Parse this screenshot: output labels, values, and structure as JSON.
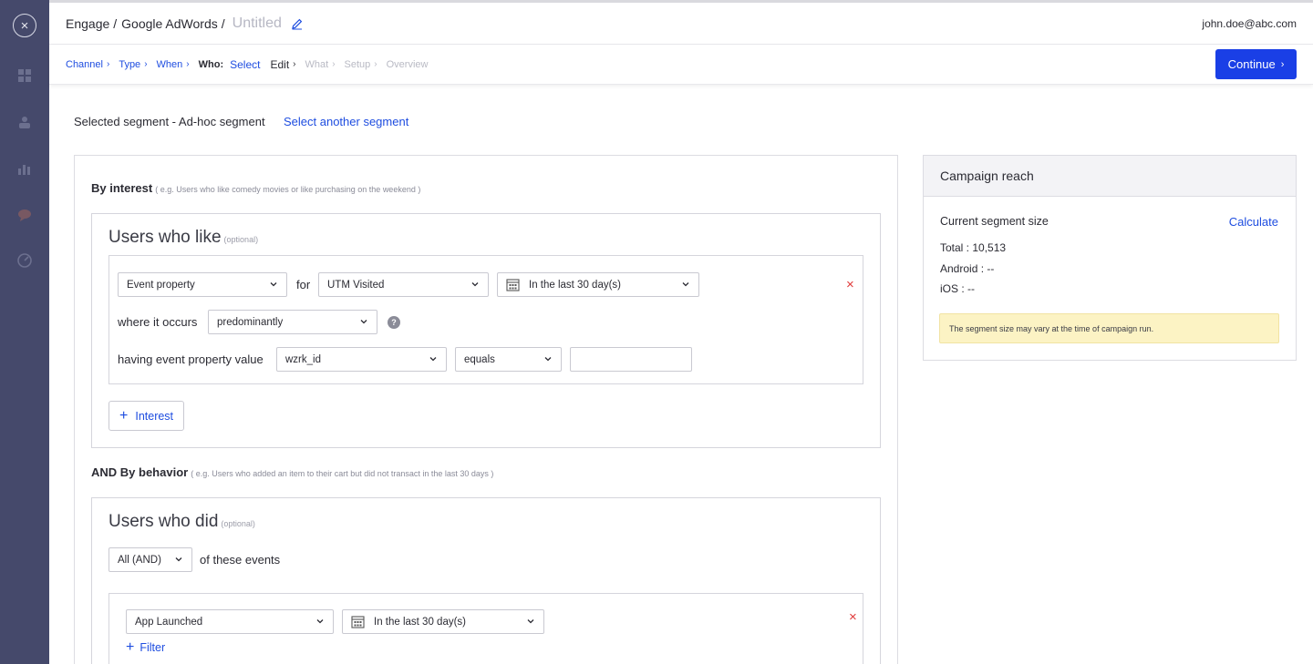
{
  "sidebar": {
    "close_symbol": "×",
    "items": [
      {
        "icon": "dashboard-icon"
      },
      {
        "icon": "segments-icon"
      },
      {
        "icon": "analytics-icon"
      },
      {
        "icon": "engage-icon"
      },
      {
        "icon": "gauge-icon"
      }
    ]
  },
  "header": {
    "crumb_1": "Engage",
    "crumb_2": "Google AdWords",
    "separator": "/",
    "title": "Untitled",
    "user_email": "john.doe@abc.com"
  },
  "steps": {
    "channel": "Channel",
    "type": "Type",
    "when": "When",
    "who": "Who:",
    "select": "Select",
    "edit": "Edit",
    "what": "What",
    "setup": "Setup",
    "overview": "Overview",
    "continue_label": "Continue"
  },
  "segment": {
    "selected_text": "Selected segment - Ad-hoc segment",
    "select_another": "Select another segment"
  },
  "interest": {
    "title": "By interest",
    "hint": "( e.g. Users who like comedy movies or like purchasing on the weekend )",
    "box_title": "Users who like",
    "optional": "(optional)",
    "property_select": "Event property",
    "for_label": "for",
    "event_select": "UTM Visited",
    "time_select": "In the last 30 day(s)",
    "where_label": "where it occurs",
    "occurs_select": "predominantly",
    "help": "?",
    "having_label": "having event property value",
    "value_select": "wzrk_id",
    "operator_select": "equals",
    "value_input": "",
    "remove": "×",
    "add_label": "Interest"
  },
  "behavior": {
    "title": "AND By behavior",
    "hint": "( e.g. Users who added an item to their cart but did not transact in the last 30 days )",
    "box_title": "Users who did",
    "optional": "(optional)",
    "combinator_select": "All (AND)",
    "of_these_label": "of these events",
    "event_select": "App Launched",
    "time_select": "In the last 30 day(s)",
    "remove": "×",
    "filter_label": "Filter"
  },
  "reach": {
    "title": "Campaign reach",
    "current_size_label": "Current segment size",
    "calculate": "Calculate",
    "total": "Total : 10,513",
    "android": "Android : --",
    "ios": "iOS : --",
    "notice": "The segment size may vary at the time of campaign run."
  },
  "colors": {
    "accent": "#1a3fe6",
    "link": "#1e4de0",
    "sidebar": "#45496b",
    "danger": "#e03a3a",
    "notice_bg": "#fcf3c4"
  }
}
